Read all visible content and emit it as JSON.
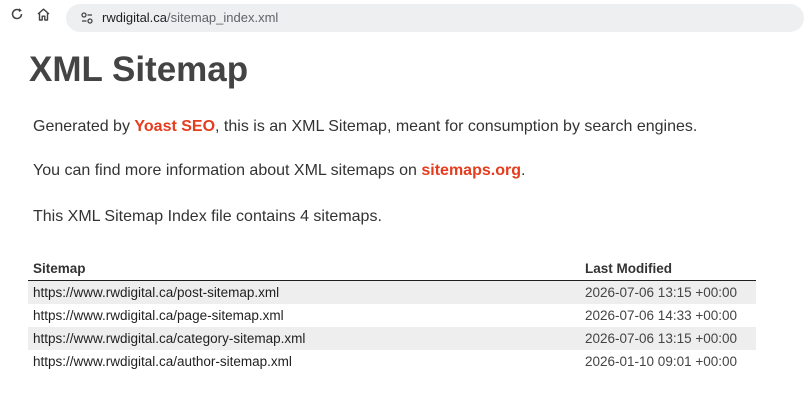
{
  "browser": {
    "url_host": "rwdigital.ca",
    "url_path": "/sitemap_index.xml",
    "reload_icon": "reload-icon",
    "home_icon": "home-icon",
    "site_info_icon": "tune-icon"
  },
  "page": {
    "title": "XML Sitemap",
    "generated_prefix": "Generated by ",
    "generator_link": "Yoast SEO",
    "generated_suffix": ", this is an XML Sitemap, meant for consumption by search engines.",
    "info_prefix": "You can find more information about XML sitemaps on ",
    "info_link": "sitemaps.org",
    "info_suffix": ".",
    "count_text": "This XML Sitemap Index file contains 4 sitemaps.",
    "link_color": "#e53c1e"
  },
  "table": {
    "headers": {
      "sitemap": "Sitemap",
      "last_modified": "Last Modified"
    },
    "rows": [
      {
        "loc": "https://www.rwdigital.ca/post-sitemap.xml",
        "lastmod": "2026-07-06 13:15 +00:00"
      },
      {
        "loc": "https://www.rwdigital.ca/page-sitemap.xml",
        "lastmod": "2026-07-06 14:33 +00:00"
      },
      {
        "loc": "https://www.rwdigital.ca/category-sitemap.xml",
        "lastmod": "2026-07-06 13:15 +00:00"
      },
      {
        "loc": "https://www.rwdigital.ca/author-sitemap.xml",
        "lastmod": "2026-01-10 09:01 +00:00"
      }
    ]
  }
}
